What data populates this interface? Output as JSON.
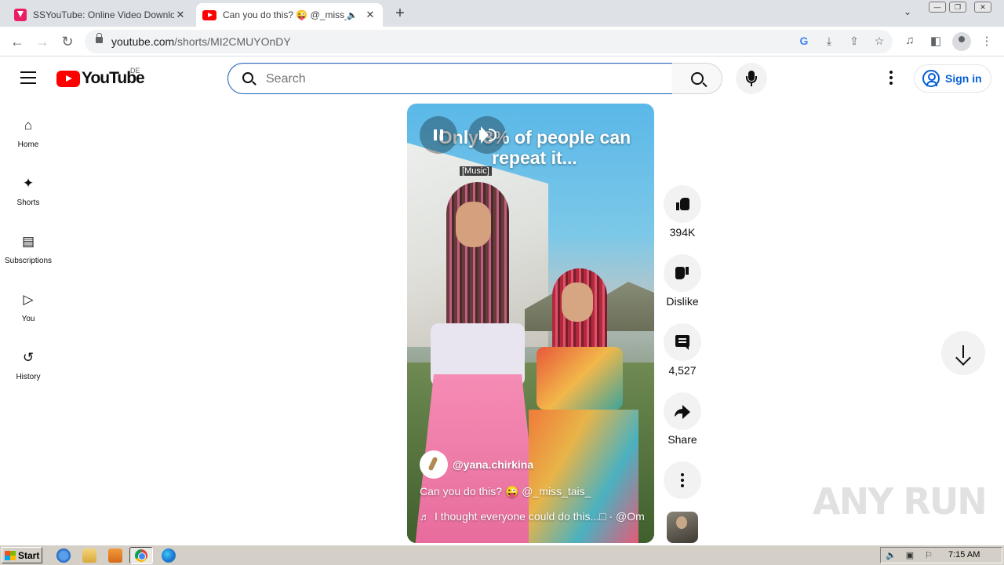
{
  "browser": {
    "tabs": [
      {
        "title": "SSYouTube: Online Video Downloade",
        "favicon": "ssyoutube-icon"
      },
      {
        "title": "Can you do this? 😜 @_miss_tai",
        "favicon": "youtube-icon",
        "audio": "🔈"
      }
    ],
    "new_tab": "+",
    "url_host": "youtube.com",
    "url_path": "/shorts/MI2CMUYOnDY"
  },
  "youtube": {
    "logo_text": "YouTube",
    "country_code": "DE",
    "search_placeholder": "Search",
    "sign_in": "Sign in",
    "sidebar": [
      {
        "label": "Home",
        "icon": "⌂"
      },
      {
        "label": "Shorts",
        "icon": "✦"
      },
      {
        "label": "Subscriptions",
        "icon": "▤"
      },
      {
        "label": "You",
        "icon": "▷"
      },
      {
        "label": "History",
        "icon": "↺"
      }
    ],
    "short": {
      "overlay_text": "Only 3% of people can repeat it...",
      "caption": "[Music]",
      "channel": "@yana.chirkina",
      "title": "Can you do this? 😜 @_miss_tais_",
      "music": "I thought everyone could do this...□ · @Om"
    },
    "actions": {
      "likes": "394K",
      "dislike": "Dislike",
      "comments": "4,527",
      "share": "Share"
    }
  },
  "watermark": "ANY RUN",
  "taskbar": {
    "start": "Start",
    "clock": "7:15 AM"
  },
  "colors": {
    "youtube_red": "#ff0000",
    "sign_in_blue": "#065fd4",
    "search_focus": "#1c62b9"
  }
}
